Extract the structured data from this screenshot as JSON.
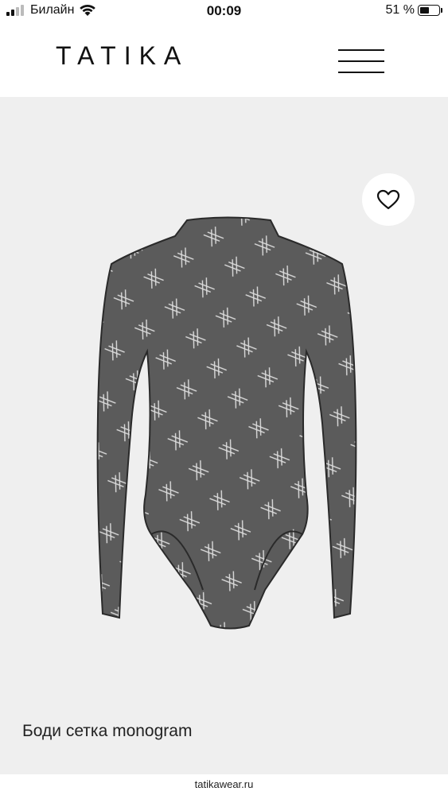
{
  "status_bar": {
    "carrier": "Билайн",
    "time": "00:09",
    "battery_text": "51 %",
    "battery_level": 0.51
  },
  "header": {
    "logo": "TATIKA",
    "menu_icon": "hamburger-menu-icon"
  },
  "product": {
    "title": "Боди сетка monogram",
    "favorite_icon": "heart-icon",
    "background_color": "#efefef"
  },
  "browser": {
    "url": "tatikawear.ru"
  }
}
